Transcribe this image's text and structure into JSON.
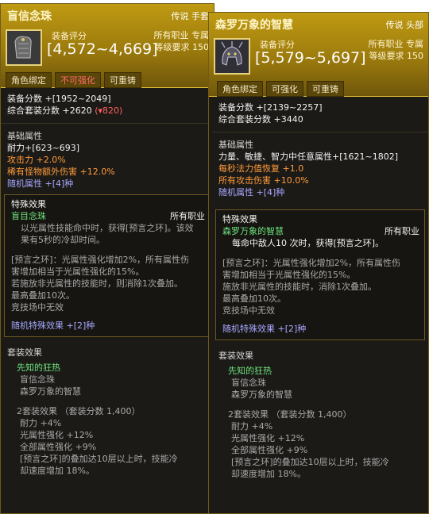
{
  "tipA": {
    "name": "盲信念珠",
    "rarity": "传说 手套",
    "icon": "gauntlet-icon",
    "score_label": "装备评分",
    "score_value": "[4,572~4,669]",
    "job": "所有职业 专属",
    "level_req": "等级要求 150",
    "tags": [
      "角色绑定",
      "不可强化",
      "可重铸"
    ],
    "stats": {
      "score": "装备分数 +[1952~2049]",
      "set_score_prefix": "综合套装分数 +2620",
      "set_score_change": "(▾820)"
    },
    "base": {
      "title": "基础属性",
      "lines": [
        {
          "text": "耐力+[623~693]",
          "color": "white"
        },
        {
          "text": "攻击力 +2.0%",
          "color": "orange"
        },
        {
          "text": "稀有怪物额外伤害 +12.0%",
          "color": "orange"
        },
        {
          "text": "随机属性 +[4]种",
          "color": "blue"
        }
      ]
    },
    "special": {
      "title": "特殊效果",
      "name": "盲目念珠",
      "job": "所有职业",
      "desc": [
        "以光属性技能命中时，获得[预言之环]。该效",
        "果有5秒的冷却时间。"
      ],
      "ring": [
        "[预言之环]：光属性强化增加2%，所有属性伤",
        "害增加相当于光属性强化的15%。",
        "若施放非光属性的技能时，则消除1次叠加。",
        "最高叠加10次。",
        "竞技场中无效"
      ],
      "random": "随机特殊效果 +[2]种"
    },
    "set": {
      "title": "套装效果",
      "name": "先知的狂热",
      "members": [
        "盲信念珠",
        "森罗万象的智慧"
      ],
      "bonus_title": "2套装效果 （套装分数 1,400）",
      "bonus": [
        "耐力 +4%",
        "光属性强化 +12%",
        "全部属性强化 +9%",
        "[预言之环]的叠加达10层以上时，技能冷",
        "却速度增加 18%。"
      ]
    }
  },
  "tipB": {
    "name": "森罗万象的智慧",
    "rarity": "传说 头部",
    "icon": "helmet-icon",
    "score_label": "装备评分",
    "score_value": "[5,579~5,697]",
    "job": "所有职业 专属",
    "level_req": "等级要求 150",
    "tags": [
      "角色绑定",
      "可强化",
      "可重铸"
    ],
    "stats": {
      "score": "装备分数 +[2139~2257]",
      "set_score": "综合套装分数 +3440"
    },
    "base": {
      "title": "基础属性",
      "lines": [
        {
          "text": "力量、敏捷、智力中任意属性+[1621~1802]",
          "color": "white"
        },
        {
          "text": "每秒法力值恢复 +1.0",
          "color": "orange"
        },
        {
          "text": "所有攻击伤害 +10.0%",
          "color": "orange"
        },
        {
          "text": "随机属性 +[4]种",
          "color": "blue"
        }
      ]
    },
    "special": {
      "title": "特殊效果",
      "name": "森罗万象的智慧",
      "job": "所有职业",
      "desc": [
        "每命中敌人10 次时，获得[预言之环]。"
      ],
      "ring": [
        "[预言之环]：光属性强化增加2%，所有属性伤",
        "害增加相当于光属性强化的15%。",
        "施放非光属性的技能时，消除1次叠加。",
        "最高叠加10次。",
        "竞技场中无效"
      ],
      "random": "随机特殊效果 +[2]种"
    },
    "set": {
      "title": "套装效果",
      "name": "先知的狂热",
      "members": [
        "盲信念珠",
        "森罗万象的智慧"
      ],
      "bonus_title": "2套装效果 （套装分数 1,400）",
      "bonus": [
        "耐力 +4%",
        "光属性强化 +12%",
        "全部属性强化 +9%",
        "[预言之环]的叠加达10层以上时，技能冷",
        "却速度增加 18%。"
      ]
    }
  }
}
